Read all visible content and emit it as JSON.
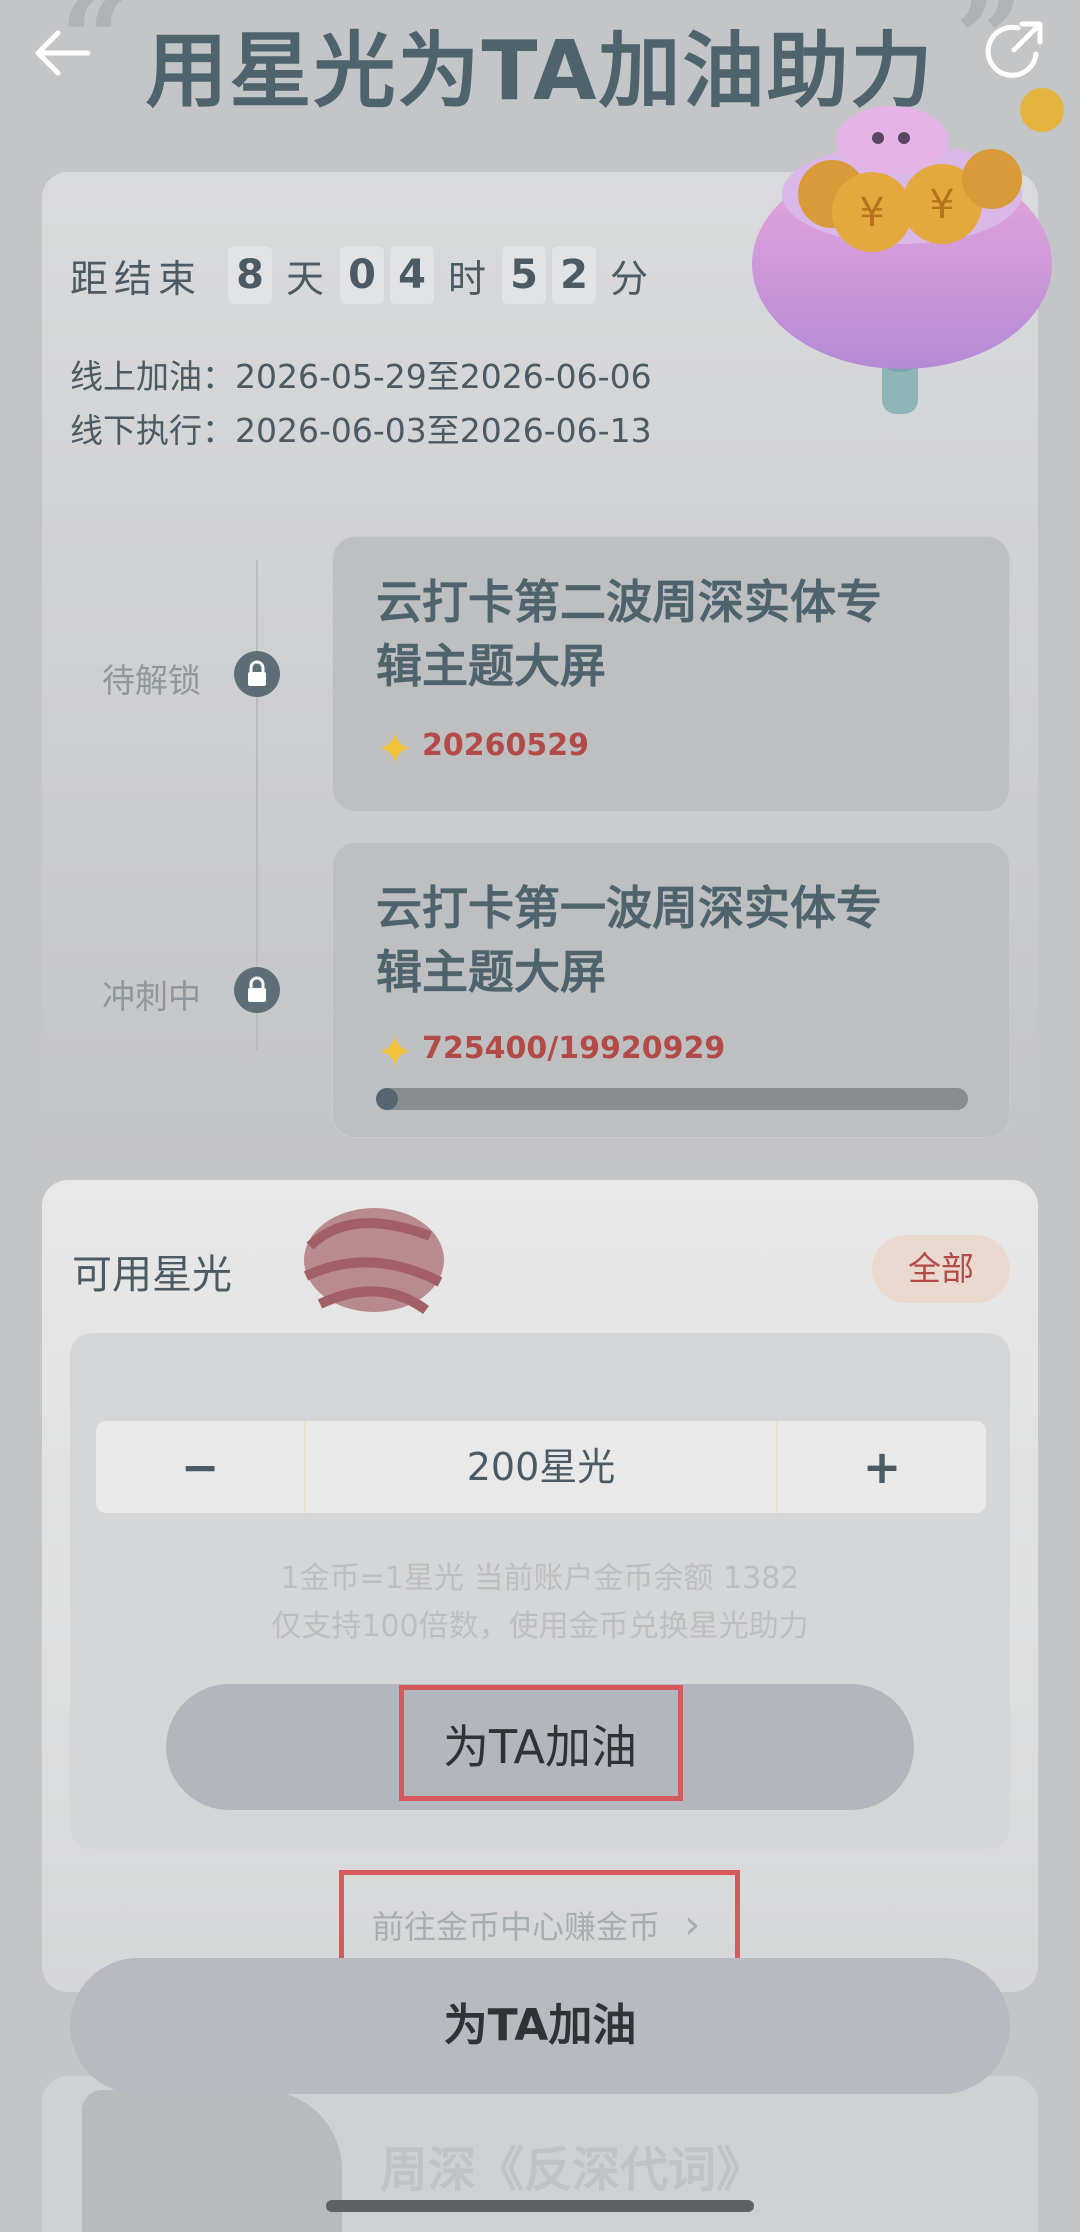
{
  "header": {
    "title": "用星光为TA加油助力",
    "quote_left": "“",
    "quote_right": "”"
  },
  "countdown": {
    "label": "距结束",
    "days_digits": [
      "8"
    ],
    "days_unit": "天",
    "hours_digits": [
      "0",
      "4"
    ],
    "hours_unit": "时",
    "minutes_digits": [
      "5",
      "2"
    ],
    "minutes_unit": "分"
  },
  "schedule": {
    "online": "线上加油：2026-05-29至2026-06-06",
    "offline": "线下执行：2026-06-03至2026-06-13"
  },
  "goals": [
    {
      "status": "待解锁",
      "title_line1": "云打卡第二波周深实体专",
      "title_line2": "辑主题大屏",
      "count": "20260529"
    },
    {
      "status": "冲刺中",
      "title_line1": "云打卡第一波周深实体专",
      "title_line2": "辑主题大屏",
      "count": "725400/19920929",
      "progress": 0.036
    }
  ],
  "starlight": {
    "label": "可用星光",
    "all_button": "全部",
    "minus": "−",
    "value": "200星光",
    "plus": "+",
    "hint_line1": "1金币=1星光 当前账户金币余额 1382",
    "hint_line2": "仅支持100倍数，使用金币兑换星光助力",
    "cheer_button": "为TA加油",
    "earn_link": "前往金币中心赚金币",
    "earn_chevron": "›"
  },
  "bottom_bar": {
    "cheer_button": "为TA加油"
  },
  "peek": {
    "title": "周深《反深代词》"
  },
  "colors": {
    "accent_red": "#b24b48",
    "title_teal": "#4e636c",
    "annotation_red": "#d65a5c"
  }
}
